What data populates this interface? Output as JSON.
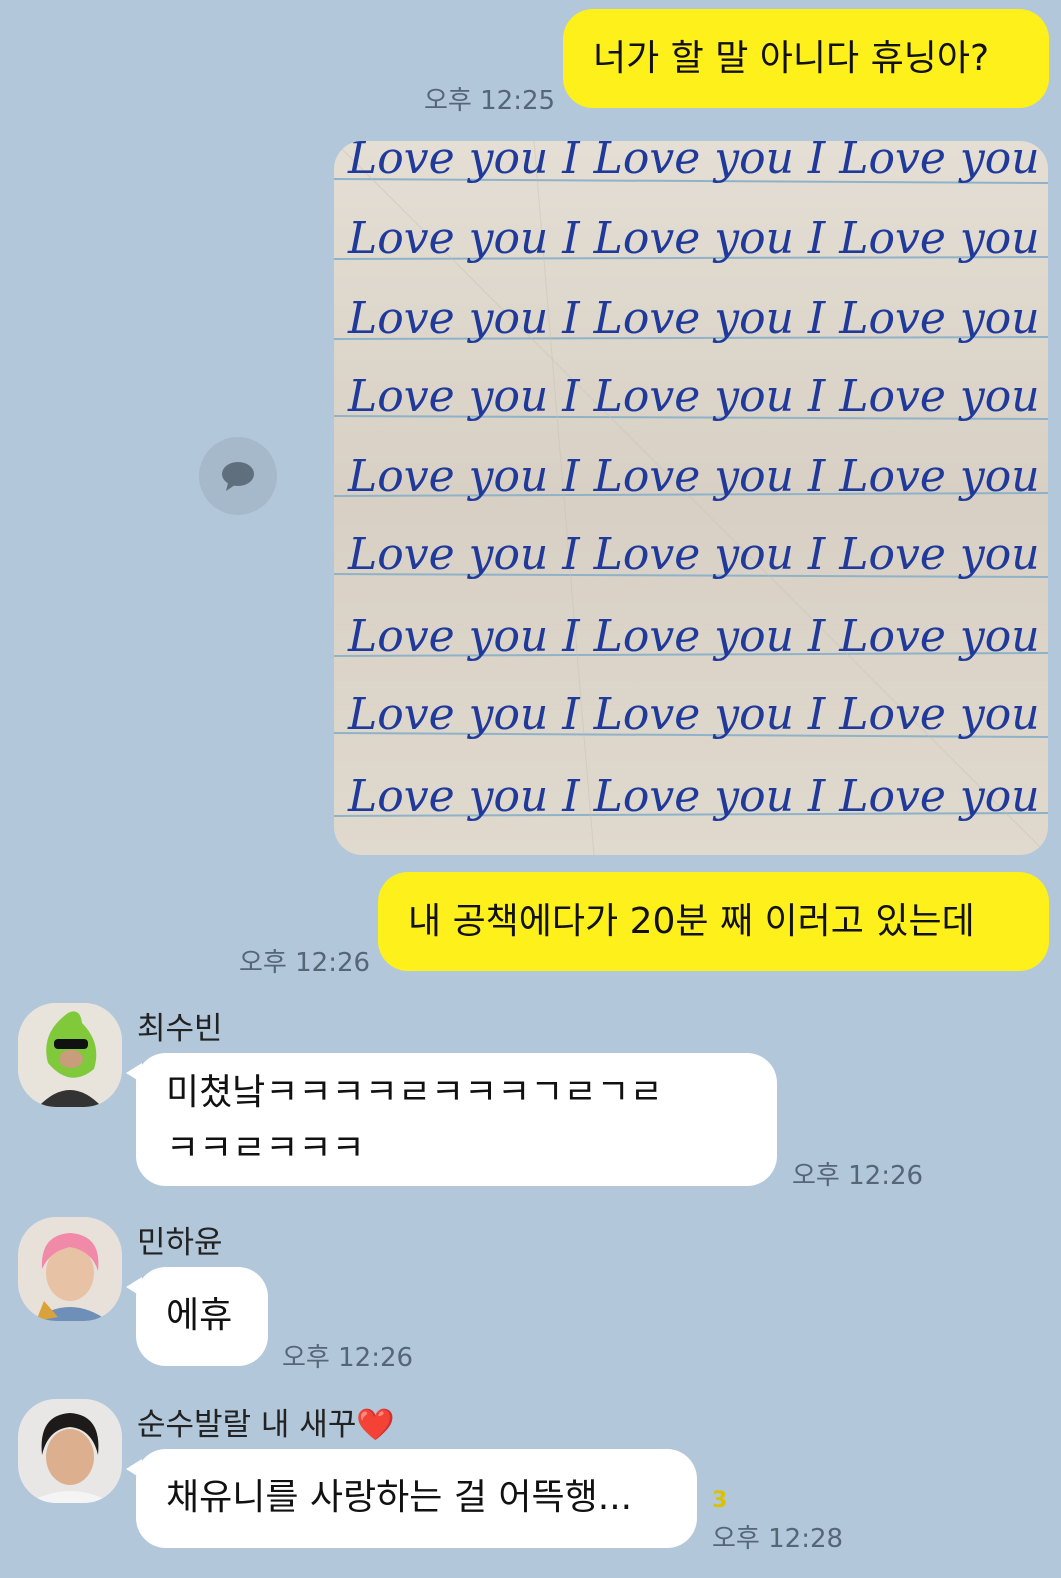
{
  "messages": {
    "m1": {
      "text": "너가 할 말 아니다 휴닝아?",
      "time": "오후 12:25"
    },
    "m3": {
      "text": "내 공책에다가 20분 째 이러고 있는데",
      "time": "오후 12:26"
    },
    "m4": {
      "sender": "최수빈",
      "text": "미쳤낰ㅋㅋㅋㅋㄹㅋㅋㅋㄱㄹㄱㄹ\nㅋㅋㄹㅋㅋㅋ",
      "time": "오후 12:26"
    },
    "m5": {
      "sender": "민하윤",
      "text": "에휴",
      "time": "오후 12:26"
    },
    "m6": {
      "sender": "순수발랄 내 새꾸",
      "sender_emoji": "❤️",
      "text": "채유니를 사랑하는 걸 어뜩행...",
      "time": "오후 12:28",
      "unread": "3"
    }
  },
  "photo": {
    "lines": [
      "Love you I Love you I Love you",
      "Love you I Love you I Love you",
      "Love you I Love you I Love you",
      "Love you I Love you I Love you",
      "Love you I Love you I Love you",
      "Love you I Love you I Love you",
      "Love you I Love you I Love you",
      "Love you I Love you I Love you",
      "Love you I Love you I Love you"
    ]
  },
  "icons": {
    "share": "speech-bubble-icon"
  },
  "colors": {
    "background": "#b2c7da",
    "my_bubble": "#fef01b",
    "their_bubble": "#ffffff",
    "ink": "#1f3a9a",
    "ruled_line": "#8fb2c9"
  }
}
